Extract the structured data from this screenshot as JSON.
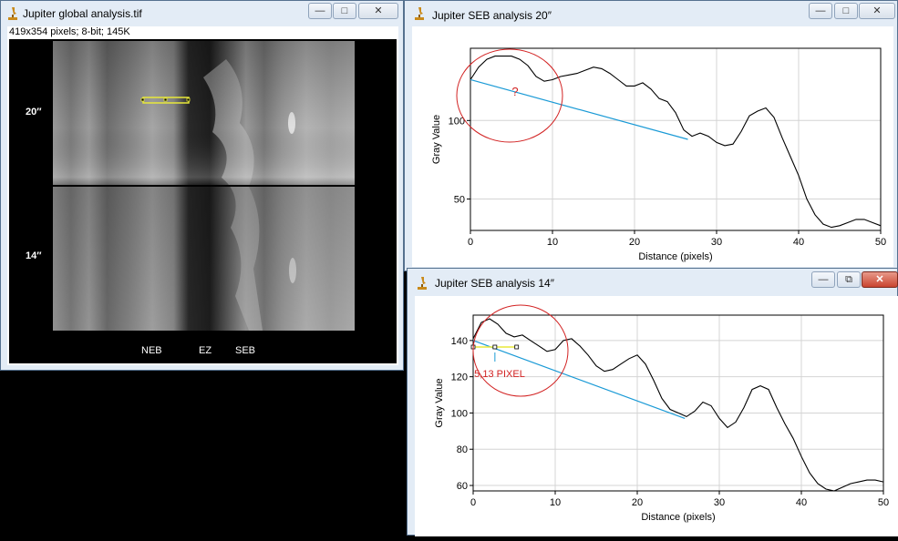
{
  "global_window": {
    "title": "Jupiter  global analysis.tif",
    "info": "419x354 pixels; 8-bit; 145K",
    "label_top": "20″",
    "label_bottom": "14″",
    "band_labels": [
      "NEB",
      "EZ",
      "SEB"
    ],
    "minimize_icon": "minimize-icon",
    "maximize_icon": "maximize-icon",
    "close_icon": "close-icon"
  },
  "plot20_window": {
    "title": "Jupiter SEB  analysis 20″",
    "annotation": "?"
  },
  "plot14_window": {
    "title": "Jupiter  SEB analysis 14″",
    "annotation": "5,13 PIXEL"
  },
  "colors": {
    "plot_line": "#000000",
    "trend_line": "#1a9ad6",
    "annotation_circle": "#d22222",
    "selection": "#e8e83a"
  },
  "chart_data": [
    {
      "type": "line",
      "title": "",
      "xlabel": "Distance (pixels)",
      "ylabel": "Gray Value",
      "xlim": [
        0,
        50
      ],
      "ylim": [
        30,
        146
      ],
      "xticks": [
        0,
        10,
        20,
        30,
        40,
        50
      ],
      "yticks": [
        50,
        100
      ],
      "grid": true,
      "series": [
        {
          "x": [
            0,
            1,
            2,
            3,
            4,
            5,
            6,
            7,
            8,
            9,
            10,
            11,
            12,
            13,
            14,
            15,
            16,
            17,
            18,
            19,
            20,
            21,
            22,
            23,
            24,
            25,
            26,
            27,
            28,
            29,
            30,
            31,
            32,
            33,
            34,
            35,
            36,
            37,
            38,
            39,
            40,
            41,
            42,
            43,
            44,
            45,
            46,
            47,
            48,
            49,
            50
          ],
          "values": [
            126,
            134,
            139,
            141,
            141,
            141,
            139,
            135,
            128,
            125,
            126,
            128,
            129,
            130,
            132,
            134,
            133,
            130,
            126,
            122,
            122,
            124,
            120,
            114,
            112,
            105,
            94,
            90,
            92,
            90,
            86,
            84,
            85,
            93,
            103,
            106,
            108,
            102,
            89,
            77,
            65,
            50,
            40,
            34,
            32,
            33,
            35,
            37,
            37,
            35,
            33
          ]
        }
      ],
      "trend_line": {
        "x": [
          0,
          26.5
        ],
        "y": [
          126,
          88
        ]
      }
    },
    {
      "type": "line",
      "title": "",
      "xlabel": "Distance (pixels)",
      "ylabel": "Gray Value",
      "xlim": [
        0,
        50
      ],
      "ylim": [
        57,
        154
      ],
      "xticks": [
        0,
        10,
        20,
        30,
        40,
        50
      ],
      "yticks": [
        60,
        80,
        100,
        120,
        140
      ],
      "grid": true,
      "series": [
        {
          "x": [
            0,
            1,
            2,
            3,
            4,
            5,
            6,
            7,
            8,
            9,
            10,
            11,
            12,
            13,
            14,
            15,
            16,
            17,
            18,
            19,
            20,
            21,
            22,
            23,
            24,
            25,
            26,
            27,
            28,
            29,
            30,
            31,
            32,
            33,
            34,
            35,
            36,
            37,
            38,
            39,
            40,
            41,
            42,
            43,
            44,
            45,
            46,
            47,
            48,
            49,
            50
          ],
          "values": [
            141,
            150,
            152,
            149,
            144,
            142,
            143,
            140,
            137,
            134,
            135,
            140,
            141,
            137,
            132,
            126,
            123,
            124,
            127,
            130,
            132,
            127,
            118,
            108,
            102,
            100,
            98,
            101,
            106,
            104,
            97,
            92,
            95,
            103,
            113,
            115,
            113,
            103,
            94,
            86,
            76,
            67,
            61,
            58,
            57,
            59,
            61,
            62,
            63,
            63,
            62
          ]
        }
      ],
      "trend_line": {
        "x": [
          0,
          25.8
        ],
        "y": [
          140,
          97
        ]
      },
      "selection": {
        "x": [
          0,
          5.3
        ]
      }
    }
  ]
}
